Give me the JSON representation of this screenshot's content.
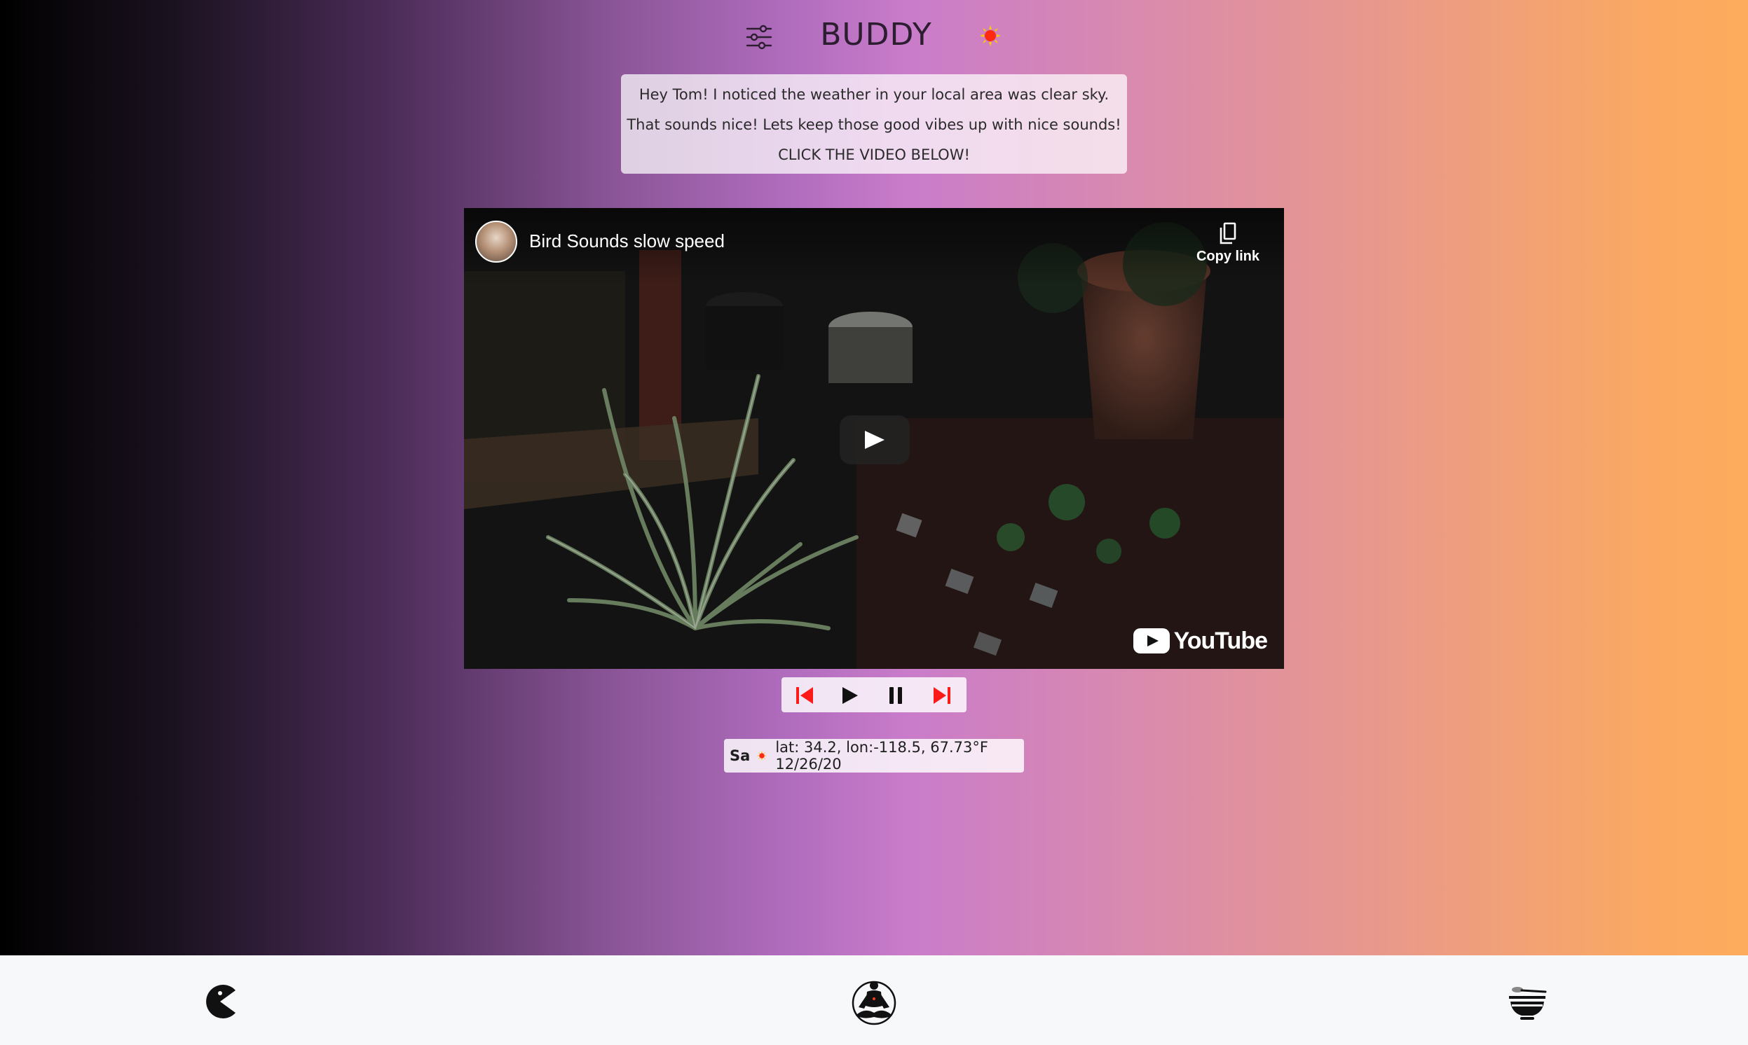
{
  "header": {
    "title": "BUDDY",
    "settings_icon": "sliders-icon",
    "weather_icon": "sun-icon"
  },
  "message": {
    "line1": "Hey Tom! I noticed the weather in your local area was clear sky.",
    "line2": "That sounds nice! Lets keep those good vibes up with nice sounds!",
    "line3": "CLICK THE VIDEO BELOW!"
  },
  "video": {
    "title": "Bird Sounds slow speed",
    "copy_link_label": "Copy link",
    "brand": "YouTube"
  },
  "controls": {
    "previous_icon": "skip-previous-icon",
    "play_icon": "play-icon",
    "pause_icon": "pause-icon",
    "next_icon": "skip-next-icon",
    "accent_color": "#ff1a1a"
  },
  "info": {
    "day": "Sa",
    "details": "lat: 34.2, lon:-118.5, 67.73°F 12/26/20"
  },
  "bottom_nav": {
    "items": [
      {
        "icon": "pacman-icon"
      },
      {
        "icon": "meditation-icon"
      },
      {
        "icon": "bowl-icon"
      }
    ]
  },
  "colors": {
    "gradient_left": "#000000",
    "gradient_mid": "#c97cca",
    "gradient_right": "#fdab5c",
    "sun": "#ff3b1f"
  }
}
